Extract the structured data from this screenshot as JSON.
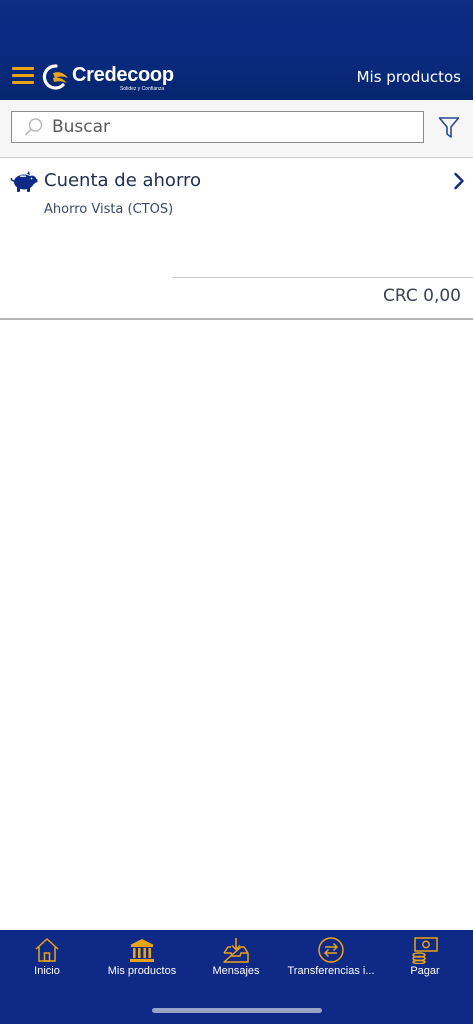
{
  "header": {
    "brand": "Credecoop",
    "tagline": "Solidez y Confianza",
    "title": "Mis productos"
  },
  "search": {
    "placeholder": "Buscar",
    "value": ""
  },
  "products": [
    {
      "name": "Cuenta de ahorro",
      "subtitle": "Ahorro Vista (CTOS)",
      "balance": "CRC 0,00"
    }
  ],
  "tabs": [
    {
      "label": "Inicio",
      "icon": "home-icon"
    },
    {
      "label": "Mis productos",
      "icon": "bank-icon"
    },
    {
      "label": "Mensajes",
      "icon": "inbox-icon"
    },
    {
      "label": "Transferencias i...",
      "icon": "transfer-icon"
    },
    {
      "label": "Pagar",
      "icon": "payment-icon"
    }
  ],
  "colors": {
    "primary": "#0e2a86",
    "accent": "#e8a317",
    "text_dark": "#1f2d4f"
  }
}
